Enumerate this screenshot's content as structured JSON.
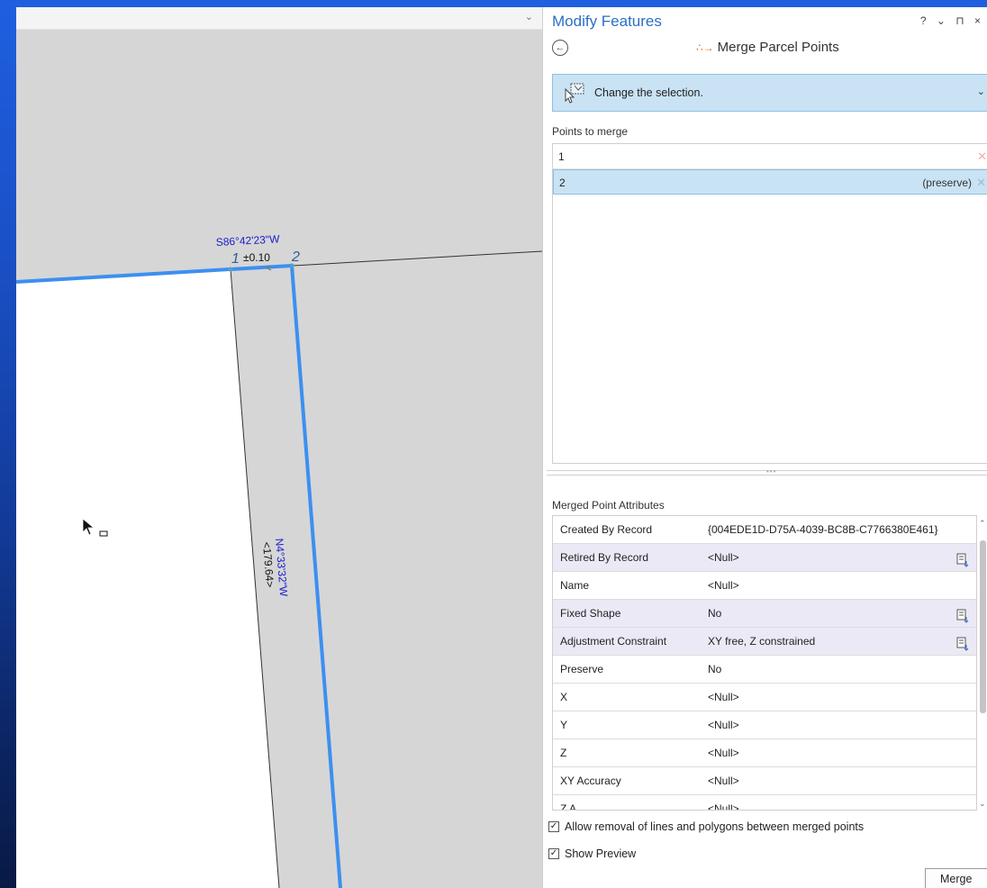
{
  "map": {
    "labels": {
      "top_bearing": "S86°42'23\"W",
      "top_accuracy": "±0.10",
      "point1": "1",
      "point2": "2",
      "side_bearing": "N4°33'32\"W",
      "side_distance": "<179.64>"
    },
    "colors": {
      "selected_line": "#3d8ff0",
      "parcel_fill": "#ffffff",
      "map_bg": "#d6d6d6",
      "label_blue": "#1a1acc"
    }
  },
  "panel": {
    "title": "Modify Features",
    "title_controls": "? ⌄ ⊓ ×",
    "tool_title": "Merge Parcel Points",
    "guide_text": "Change the selection.",
    "points_label": "Points to merge",
    "points": [
      {
        "label": "1",
        "note": ""
      },
      {
        "label": "2",
        "note": "(preserve)"
      }
    ],
    "attributes_label": "Merged Point Attributes",
    "attributes": [
      {
        "name": "Created By Record",
        "value": "{004EDE1D-D75A-4039-BC8B-C7766380E461}"
      },
      {
        "name": "Retired By Record",
        "value": "<Null>"
      },
      {
        "name": "Name",
        "value": "<Null>"
      },
      {
        "name": "Fixed Shape",
        "value": "No"
      },
      {
        "name": "Adjustment Constraint",
        "value": "XY free, Z constrained"
      },
      {
        "name": "Preserve",
        "value": "No"
      },
      {
        "name": "X",
        "value": "<Null>"
      },
      {
        "name": "Y",
        "value": "<Null>"
      },
      {
        "name": "Z",
        "value": "<Null>"
      },
      {
        "name": "XY Accuracy",
        "value": "<Null>"
      },
      {
        "name": "Z A...",
        "value": "<Null>"
      }
    ],
    "allow_removal_label": "Allow removal of lines and polygons between merged points",
    "show_preview_label": "Show Preview",
    "merge_button": "Merge",
    "accent_color": "#2b6fc6"
  }
}
